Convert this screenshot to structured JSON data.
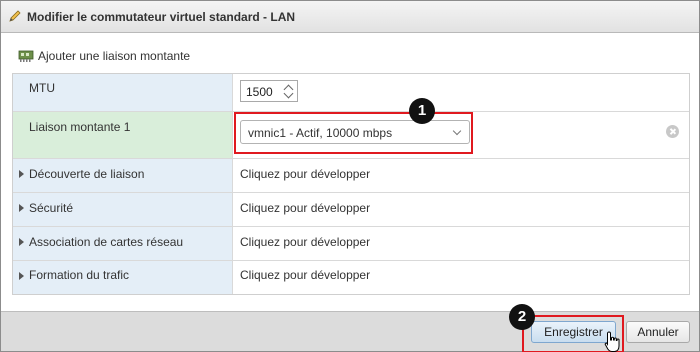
{
  "dialog": {
    "title": "Modifier le commutateur virtuel standard - LAN",
    "add_uplink_label": "Ajouter une liaison montante"
  },
  "properties": {
    "mtu": {
      "label": "MTU",
      "value": "1500"
    },
    "uplink": {
      "label": "Liaison montante 1",
      "value": "vmnic1 - Actif, 10000 mbps"
    },
    "rows": [
      {
        "label": "Découverte de liaison",
        "value": "Cliquez pour développer"
      },
      {
        "label": "Sécurité",
        "value": "Cliquez pour développer"
      },
      {
        "label": "Association de cartes réseau",
        "value": "Cliquez pour développer"
      },
      {
        "label": "Formation du trafic",
        "value": "Cliquez pour développer"
      }
    ]
  },
  "callouts": {
    "one": "1",
    "two": "2"
  },
  "footer": {
    "save_label": "Enregistrer",
    "cancel_label": "Annuler"
  },
  "colors": {
    "highlight": "#e0191f",
    "label_bg": "#e4eef7",
    "label_bg_active": "#d9eeda"
  },
  "icons": [
    "pencil-icon",
    "network-adapter-icon",
    "spin-up-icon",
    "spin-down-icon",
    "chevron-down-icon",
    "remove-icon",
    "expand-arrow-icon",
    "hand-cursor-icon"
  ]
}
